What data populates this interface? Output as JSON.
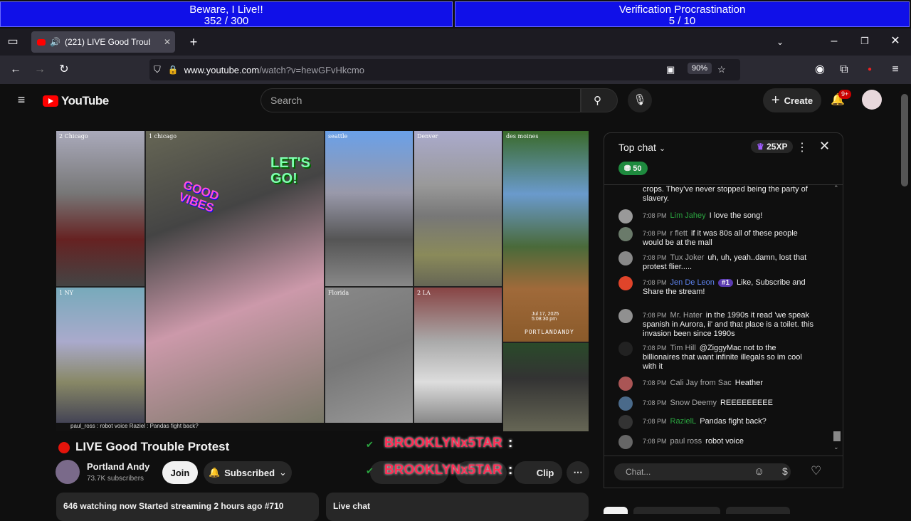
{
  "overlay": {
    "goal1": {
      "title": "Beware, I Live!!",
      "progress": "352  / 300"
    },
    "goal2": {
      "title": "Verification Procrastination",
      "progress": "5 / 10"
    }
  },
  "browser": {
    "tab_title": "(221)  LIVE Good Troubl",
    "new_tab": "+",
    "url_host": "www.youtube.com",
    "url_path": "/watch?v=hewGFvHkcmo",
    "zoom": "90%"
  },
  "youtube": {
    "logo_text": "YouTube",
    "search_placeholder": "Search",
    "create_label": "Create",
    "notif_badge": "9+",
    "video_title": "LIVE Good Trouble Protest",
    "channel_name": "Portland Andy",
    "subscribers": "73.7K subscribers",
    "join_label": "Join",
    "subscribed_label": "Subscribed",
    "clip_label": "Clip",
    "watching_text": "646 watching now  Started streaming 2 hours ago  #710",
    "live_chat_tab": "Live chat",
    "stream_caption": "paul_ross : robot voice  Raziel : Pandas fight back?",
    "overlay_user_1": "BROOKLYNx5TAR",
    "overlay_user_2": "BROOKLYNx5TAR",
    "overlay_colon": ":"
  },
  "video_cells": [
    {
      "label": "2 Chicago"
    },
    {
      "label": "1 chicago"
    },
    {
      "label": "seattle"
    },
    {
      "label": "Denver"
    },
    {
      "label": "des moines"
    },
    {
      "label": "1 NY"
    },
    {
      "label": "Florida"
    },
    {
      "label": "2 LA"
    }
  ],
  "video_text": {
    "lets_go": "LET'S GO!",
    "good_vibes": "GOOD VIBES",
    "timestamp": "Jul 17, 2025 5:08:30 pm",
    "portlandandy": "PORTLANDANDY"
  },
  "chat": {
    "header": "Top chat",
    "xp": "25XP",
    "gift_count": "50",
    "input_placeholder": "Chat...",
    "partial_message": "crops. They've never stopped being the party of slavery.",
    "messages": [
      {
        "time": "7:08 PM",
        "author": "Lim Jahey",
        "text": "I love the  song!",
        "color": "#2ba640",
        "avatar": "#999"
      },
      {
        "time": "7:08 PM",
        "author": "r flett",
        "text": "if it was 80s all of these people would be at the mall",
        "color": "#aaa",
        "avatar": "#6a7a6a"
      },
      {
        "time": "7:08 PM",
        "author": "Tux Joker",
        "text": "uh, uh, yeah..damn, lost that protest flier.....",
        "color": "#aaa",
        "avatar": "#888"
      },
      {
        "time": "7:08 PM",
        "author": "Jen De Leon",
        "text": "Like, Subscribe and Share the stream! ",
        "color": "#5e84f1",
        "avatar": "#e0442a",
        "badge": "#1"
      },
      {
        "time": "7:08 PM",
        "author": "Mr. Hater",
        "text": "in the 1990s it read 'we speak spanish in Aurora, il' and that place is a toilet. this invasion been since 1990s",
        "color": "#aaa",
        "avatar": "#909090"
      },
      {
        "time": "7:08 PM",
        "author": "Tim Hill",
        "text": "@ZiggyMac not to the billionaires that want infinite illegals so im cool with it",
        "color": "#aaa",
        "avatar": "#222"
      },
      {
        "time": "7:08 PM",
        "author": "Cali Jay from Sac",
        "text": "Heather ",
        "color": "#aaa",
        "avatar": "#a55"
      },
      {
        "time": "7:08 PM",
        "author": "Snow Deemy",
        "text": "REEEEEEEEE",
        "color": "#aaa",
        "avatar": "#4a6a8a"
      },
      {
        "time": "7:08 PM",
        "author": "RazielL",
        "text": "Pandas fight back?",
        "color": "#2ba640",
        "avatar": "#333"
      },
      {
        "time": "7:08 PM",
        "author": "paul ross",
        "text": "robot voice",
        "color": "#aaa",
        "avatar": "#666"
      }
    ]
  }
}
